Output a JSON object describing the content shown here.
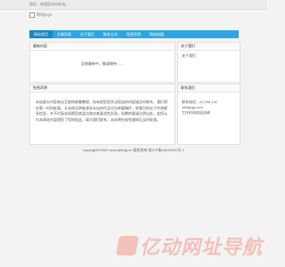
{
  "top_notice": "您好，欢迎您访问本站。",
  "logo_alt": "网站logo",
  "nav": [
    {
      "label": "网站首页",
      "active": true
    },
    {
      "label": "文章列表",
      "active": false
    },
    {
      "label": "关于我们",
      "active": false
    },
    {
      "label": "联系方式",
      "active": false
    },
    {
      "label": "免责声明",
      "active": false
    },
    {
      "label": "网站地图",
      "active": false
    }
  ],
  "panels": {
    "main_title": "最新内容",
    "main_body": "总统最新中，敬请期待……",
    "about_title": "关于我们",
    "about_body": "关于我们",
    "decl_title": "免责声明",
    "decl_body": "本站部分内容来自互联网收集整理，如有侵犯您合法权益的内容请及时联系，我们将在第一时间处理。凡本网注明来源非本站的作品均为转载稿件，转载目的在于传递更多信息，并不代表本网赞同其观点和对其真实性负责。如需转载请注明出处，若您认为本网站内容侵犯了您的权益，请与我们联系，本站将在收到通知后及时处理。",
    "contact_title": "联系我们",
    "contact_line1": "联系电话：21 205 141 189@qq.com",
    "contact_line2": "工作时间欢迎咨询"
  },
  "footer": "copyright©2020 www.djfhwjj.cn 版权所有  皖ICP备18010601号-1",
  "watermark": "亿动网址导航"
}
